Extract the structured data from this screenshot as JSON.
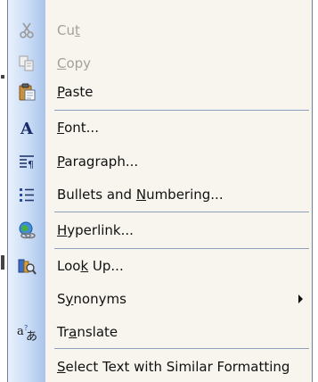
{
  "menu": {
    "items": [
      {
        "label": "Cut",
        "pre": "Cu",
        "key": "t",
        "post": "",
        "icon": "scissors-icon",
        "enabled": false
      },
      {
        "label": "Copy",
        "pre": "",
        "key": "C",
        "post": "opy",
        "icon": "copy-icon",
        "enabled": false
      },
      {
        "label": "Paste",
        "pre": "",
        "key": "P",
        "post": "aste",
        "icon": "clipboard-icon",
        "enabled": true
      },
      {
        "label": "Font...",
        "pre": "",
        "key": "F",
        "post": "ont...",
        "icon": "font-icon",
        "enabled": true
      },
      {
        "label": "Paragraph...",
        "pre": "",
        "key": "P",
        "post": "aragraph...",
        "icon": "paragraph-icon",
        "enabled": true
      },
      {
        "label": "Bullets and Numbering...",
        "pre": "Bullets and ",
        "key": "N",
        "post": "umbering...",
        "icon": "bullets-icon",
        "enabled": true
      },
      {
        "label": "Hyperlink...",
        "pre": "",
        "key": "H",
        "post": "yperlink...",
        "icon": "hyperlink-icon",
        "enabled": true
      },
      {
        "label": "Look Up...",
        "pre": "Loo",
        "key": "k",
        "post": " Up...",
        "icon": "research-icon",
        "enabled": true
      },
      {
        "label": "Synonyms",
        "pre": "S",
        "key": "y",
        "post": "nonyms",
        "icon": "",
        "enabled": true,
        "submenu": true
      },
      {
        "label": "Translate",
        "pre": "Tr",
        "key": "a",
        "post": "nslate",
        "icon": "translate-icon",
        "enabled": true
      },
      {
        "label": "Select Text with Similar Formatting",
        "pre": "",
        "key": "S",
        "post": "elect Text with Similar Formatting",
        "icon": "",
        "enabled": true
      }
    ]
  },
  "colors": {
    "menu_bg": "#f7f5ee",
    "gutter": "#c9dcf6",
    "separator": "#8c9fbd",
    "disabled_text": "#a5a09a"
  }
}
